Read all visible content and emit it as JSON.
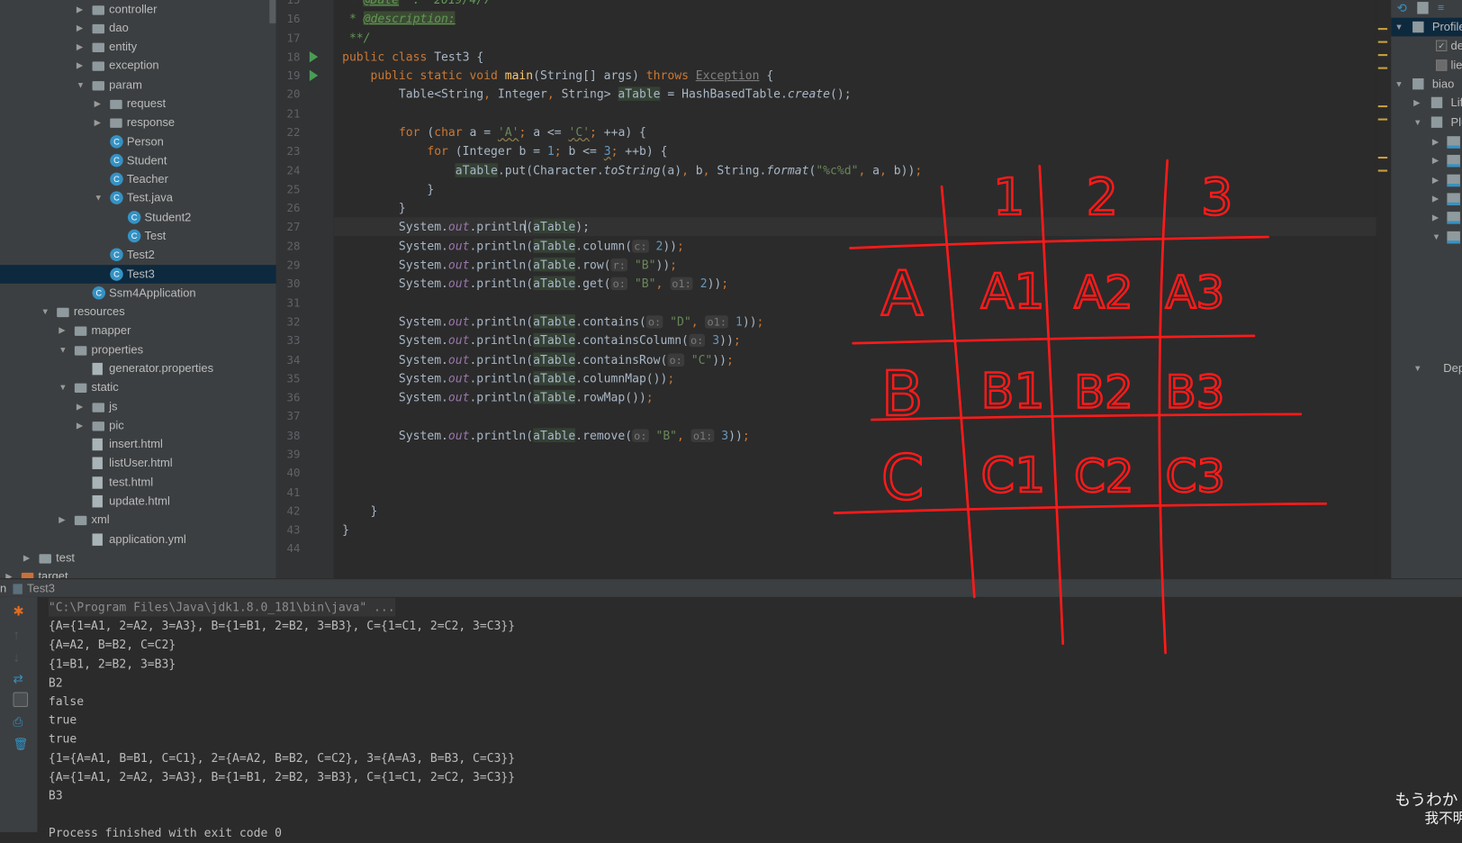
{
  "project_tree": [
    {
      "label": "controller",
      "level": 4,
      "icon": "folder",
      "arrow": "right"
    },
    {
      "label": "dao",
      "level": 4,
      "icon": "folder",
      "arrow": "right"
    },
    {
      "label": "entity",
      "level": 4,
      "icon": "folder",
      "arrow": "right"
    },
    {
      "label": "exception",
      "level": 4,
      "icon": "folder",
      "arrow": "right"
    },
    {
      "label": "param",
      "level": 4,
      "icon": "folder",
      "arrow": "down"
    },
    {
      "label": "request",
      "level": 5,
      "icon": "folder",
      "arrow": "right"
    },
    {
      "label": "response",
      "level": 5,
      "icon": "folder",
      "arrow": "right"
    },
    {
      "label": "Person",
      "level": 5,
      "icon": "class"
    },
    {
      "label": "Student",
      "level": 5,
      "icon": "class"
    },
    {
      "label": "Teacher",
      "level": 5,
      "icon": "class"
    },
    {
      "label": "Test.java",
      "level": 5,
      "icon": "class",
      "arrow": "down"
    },
    {
      "label": "Student2",
      "level": 6,
      "icon": "class"
    },
    {
      "label": "Test",
      "level": 6,
      "icon": "class"
    },
    {
      "label": "Test2",
      "level": 5,
      "icon": "class"
    },
    {
      "label": "Test3",
      "level": 5,
      "icon": "class",
      "selected": true
    },
    {
      "label": "Ssm4Application",
      "level": 4,
      "icon": "class"
    },
    {
      "label": "resources",
      "level": 2,
      "icon": "folder",
      "arrow": "down"
    },
    {
      "label": "mapper",
      "level": 3,
      "icon": "folder",
      "arrow": "right"
    },
    {
      "label": "properties",
      "level": 3,
      "icon": "folder",
      "arrow": "down"
    },
    {
      "label": "generator.properties",
      "level": 4,
      "icon": "file"
    },
    {
      "label": "static",
      "level": 3,
      "icon": "folder",
      "arrow": "down"
    },
    {
      "label": "js",
      "level": 4,
      "icon": "folder",
      "arrow": "right"
    },
    {
      "label": "pic",
      "level": 4,
      "icon": "folder",
      "arrow": "right"
    },
    {
      "label": "insert.html",
      "level": 4,
      "icon": "file"
    },
    {
      "label": "listUser.html",
      "level": 4,
      "icon": "file"
    },
    {
      "label": "test.html",
      "level": 4,
      "icon": "file"
    },
    {
      "label": "update.html",
      "level": 4,
      "icon": "file"
    },
    {
      "label": "xml",
      "level": 3,
      "icon": "folder",
      "arrow": "right"
    },
    {
      "label": "application.yml",
      "level": 4,
      "icon": "file"
    },
    {
      "label": "test",
      "level": 1,
      "icon": "folder",
      "arrow": "right"
    },
    {
      "label": "target",
      "level": 0,
      "icon": "folder-o",
      "arrow": "right"
    }
  ],
  "editor": {
    "first_line_number": 15,
    "current_line": 27,
    "run_lines": [
      18,
      19
    ],
    "lines": [
      [
        [
          " * ",
          "cmt"
        ],
        [
          "@Date",
          "tag"
        ],
        [
          "  :  2019/4/7",
          "cmt"
        ]
      ],
      [
        [
          " * ",
          "cmt"
        ],
        [
          "@description:",
          "tag"
        ]
      ],
      [
        [
          " **/",
          "cmt"
        ]
      ],
      [
        [
          "public class ",
          "kw"
        ],
        [
          "Test3 {",
          ""
        ]
      ],
      [
        [
          "    public static void ",
          "kw"
        ],
        [
          "main",
          "fn"
        ],
        [
          "(String[] args) ",
          ""
        ],
        [
          "throws ",
          "kw"
        ],
        [
          "Exception",
          "gray"
        ],
        [
          " {",
          ""
        ]
      ],
      [
        [
          "        Table<String",
          ""
        ],
        [
          ", ",
          "kw"
        ],
        [
          "Integer",
          ""
        ],
        [
          ", ",
          "kw"
        ],
        [
          "String> ",
          ""
        ],
        [
          "aTable",
          "var"
        ],
        [
          " = HashBasedTable.",
          ""
        ],
        [
          "create",
          "it"
        ],
        [
          "();",
          ""
        ]
      ],
      [],
      [
        [
          "        ",
          ""
        ],
        [
          "for ",
          "kw"
        ],
        [
          "(",
          ""
        ],
        [
          "char ",
          "kw"
        ],
        [
          "a = ",
          ""
        ],
        [
          "'A'",
          "str warn"
        ],
        [
          "; ",
          "kw"
        ],
        [
          "a <= ",
          ""
        ],
        [
          "'C'",
          "str warn"
        ],
        [
          "; ",
          "kw"
        ],
        [
          "++a) {",
          ""
        ]
      ],
      [
        [
          "            ",
          ""
        ],
        [
          "for ",
          "kw"
        ],
        [
          "(Integer b = ",
          ""
        ],
        [
          "1",
          "num"
        ],
        [
          "; ",
          "kw"
        ],
        [
          "b <= ",
          ""
        ],
        [
          "3",
          "num warn"
        ],
        [
          "; ",
          "kw"
        ],
        [
          "++b) {",
          ""
        ]
      ],
      [
        [
          "                ",
          ""
        ],
        [
          "aTable",
          "var"
        ],
        [
          ".put(Character.",
          ""
        ],
        [
          "toString",
          "it"
        ],
        [
          "(a)",
          ""
        ],
        [
          ", ",
          "kw"
        ],
        [
          "b",
          ""
        ],
        [
          ", ",
          "kw"
        ],
        [
          "String.",
          ""
        ],
        [
          "format",
          "it"
        ],
        [
          "(",
          ""
        ],
        [
          "\"%c%d\"",
          "str"
        ],
        [
          ", ",
          "kw"
        ],
        [
          "a",
          ""
        ],
        [
          ", ",
          "kw"
        ],
        [
          "b))",
          ""
        ],
        [
          ";",
          "kw"
        ]
      ],
      [
        [
          "            }",
          ""
        ]
      ],
      [
        [
          "        }",
          ""
        ]
      ],
      [
        [
          "        System.",
          ""
        ],
        [
          "out",
          "field"
        ],
        [
          ".println(",
          ""
        ],
        [
          "aTable",
          "var"
        ],
        [
          ");",
          ""
        ]
      ],
      [
        [
          "        System.",
          ""
        ],
        [
          "out",
          "field"
        ],
        [
          ".println(",
          ""
        ],
        [
          "aTable",
          "var"
        ],
        [
          ".column(",
          ""
        ],
        [
          "c:",
          "hint"
        ],
        [
          " ",
          ""
        ],
        [
          "2",
          "num"
        ],
        [
          "))",
          ""
        ],
        [
          ";",
          "kw"
        ]
      ],
      [
        [
          "        System.",
          ""
        ],
        [
          "out",
          "field"
        ],
        [
          ".println(",
          ""
        ],
        [
          "aTable",
          "var"
        ],
        [
          ".row(",
          ""
        ],
        [
          "r:",
          "hint"
        ],
        [
          " ",
          ""
        ],
        [
          "\"B\"",
          "str"
        ],
        [
          "))",
          ""
        ],
        [
          ";",
          "kw"
        ]
      ],
      [
        [
          "        System.",
          ""
        ],
        [
          "out",
          "field"
        ],
        [
          ".println(",
          ""
        ],
        [
          "aTable",
          "var"
        ],
        [
          ".get(",
          ""
        ],
        [
          "o:",
          "hint"
        ],
        [
          " ",
          ""
        ],
        [
          "\"B\"",
          "str"
        ],
        [
          ", ",
          "kw"
        ],
        [
          "o1:",
          "hint"
        ],
        [
          " ",
          ""
        ],
        [
          "2",
          "num"
        ],
        [
          "))",
          ""
        ],
        [
          ";",
          "kw"
        ]
      ],
      [],
      [
        [
          "        System.",
          ""
        ],
        [
          "out",
          "field"
        ],
        [
          ".println(",
          ""
        ],
        [
          "aTable",
          "var"
        ],
        [
          ".contains(",
          ""
        ],
        [
          "o:",
          "hint"
        ],
        [
          " ",
          ""
        ],
        [
          "\"D\"",
          "str"
        ],
        [
          ", ",
          "kw"
        ],
        [
          "o1:",
          "hint"
        ],
        [
          " ",
          ""
        ],
        [
          "1",
          "num"
        ],
        [
          "))",
          ""
        ],
        [
          ";",
          "kw"
        ]
      ],
      [
        [
          "        System.",
          ""
        ],
        [
          "out",
          "field"
        ],
        [
          ".println(",
          ""
        ],
        [
          "aTable",
          "var"
        ],
        [
          ".containsColumn(",
          ""
        ],
        [
          "o:",
          "hint"
        ],
        [
          " ",
          ""
        ],
        [
          "3",
          "num"
        ],
        [
          "))",
          ""
        ],
        [
          ";",
          "kw"
        ]
      ],
      [
        [
          "        System.",
          ""
        ],
        [
          "out",
          "field"
        ],
        [
          ".println(",
          ""
        ],
        [
          "aTable",
          "var"
        ],
        [
          ".containsRow(",
          ""
        ],
        [
          "o:",
          "hint"
        ],
        [
          " ",
          ""
        ],
        [
          "\"C\"",
          "str"
        ],
        [
          "))",
          ""
        ],
        [
          ";",
          "kw"
        ]
      ],
      [
        [
          "        System.",
          ""
        ],
        [
          "out",
          "field"
        ],
        [
          ".println(",
          ""
        ],
        [
          "aTable",
          "var"
        ],
        [
          ".columnMap())",
          ""
        ],
        [
          ";",
          "kw"
        ]
      ],
      [
        [
          "        System.",
          ""
        ],
        [
          "out",
          "field"
        ],
        [
          ".println(",
          ""
        ],
        [
          "aTable",
          "var"
        ],
        [
          ".rowMap())",
          ""
        ],
        [
          ";",
          "kw"
        ]
      ],
      [],
      [
        [
          "        System.",
          ""
        ],
        [
          "out",
          "field"
        ],
        [
          ".println(",
          ""
        ],
        [
          "aTable",
          "var"
        ],
        [
          ".remove(",
          ""
        ],
        [
          "o:",
          "hint"
        ],
        [
          " ",
          ""
        ],
        [
          "\"B\"",
          "str"
        ],
        [
          ", ",
          "kw"
        ],
        [
          "o1:",
          "hint"
        ],
        [
          " ",
          ""
        ],
        [
          "3",
          "num"
        ],
        [
          "))",
          ""
        ],
        [
          ";",
          "kw"
        ]
      ],
      [],
      [],
      [],
      [
        [
          "    }",
          ""
        ]
      ],
      [
        [
          "}",
          ""
        ]
      ],
      []
    ]
  },
  "maven_panel": {
    "items": [
      {
        "label": "Profiles",
        "level": 0,
        "arrow": "down",
        "selected": true
      },
      {
        "label": "dev",
        "level": 1,
        "checkbox": true
      },
      {
        "label": "lieti",
        "level": 1,
        "checkbox": false
      },
      {
        "label": "biao",
        "level": 0,
        "arrow": "down"
      },
      {
        "label": "Lifecycle",
        "level": 1,
        "arrow": "right"
      },
      {
        "label": "Plugins",
        "level": 1,
        "arrow": "down"
      }
    ],
    "dependencies_label": "Dependencies"
  },
  "run_tab": {
    "prefix": "n",
    "title": "Test3"
  },
  "console": {
    "lines": [
      "\"C:\\Program Files\\Java\\jdk1.8.0_181\\bin\\java\" ...",
      "{A={1=A1, 2=A2, 3=A3}, B={1=B1, 2=B2, 3=B3}, C={1=C1, 2=C2, 3=C3}}",
      "{A=A2, B=B2, C=C2}",
      "{1=B1, 2=B2, 3=B3}",
      "B2",
      "false",
      "true",
      "true",
      "{1={A=A1, B=B1, C=C1}, 2={A=A2, B=B2, C=C2}, 3={A=A3, B=B3, C=C3}}",
      "{A={1=A1, 2=A2, 3=A3}, B={1=B1, 2=B2, 3=B3}, C={1=C1, 2=C2, 3=C3}}",
      "B3",
      "",
      "Process finished with exit code 0"
    ]
  },
  "annotation": {
    "color": "#ff1a1a",
    "column_headers": [
      "1",
      "2",
      "3"
    ],
    "row_headers": [
      "A",
      "B",
      "C"
    ],
    "cells": [
      [
        "A1",
        "A2",
        "A3"
      ],
      [
        "B1",
        "B2",
        "B3"
      ],
      [
        "C1",
        "C2",
        "C3"
      ]
    ]
  },
  "subtitles": {
    "japanese": "もうわか",
    "chinese": "我不明"
  }
}
